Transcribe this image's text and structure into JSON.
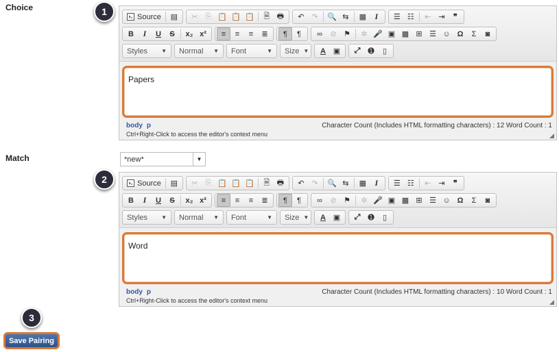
{
  "choice": {
    "label": "Choice",
    "callout": "1",
    "editor": {
      "source_label": "Source",
      "styles": "Styles",
      "format": "Normal",
      "font": "Font",
      "size": "Size",
      "text": "Papers",
      "path": [
        "body",
        "p"
      ],
      "status": "Character Count (Includes HTML formatting characters) : 12 Word Count : 1",
      "hint": "Ctrl+Right-Click to access the editor's context menu"
    }
  },
  "match": {
    "label": "Match",
    "select_value": "*new*",
    "callout": "2",
    "editor": {
      "source_label": "Source",
      "styles": "Styles",
      "format": "Normal",
      "font": "Font",
      "size": "Size",
      "text": "Word",
      "path": [
        "body",
        "p"
      ],
      "status": "Character Count (Includes HTML formatting characters) : 10 Word Count : 1",
      "hint": "Ctrl+Right-Click to access the editor's context menu"
    }
  },
  "save": {
    "callout": "3",
    "label": "Save Pairing"
  },
  "colors": {
    "highlight": "#d97a38",
    "button": "#2d5288",
    "callout": "#2c2c3a"
  }
}
